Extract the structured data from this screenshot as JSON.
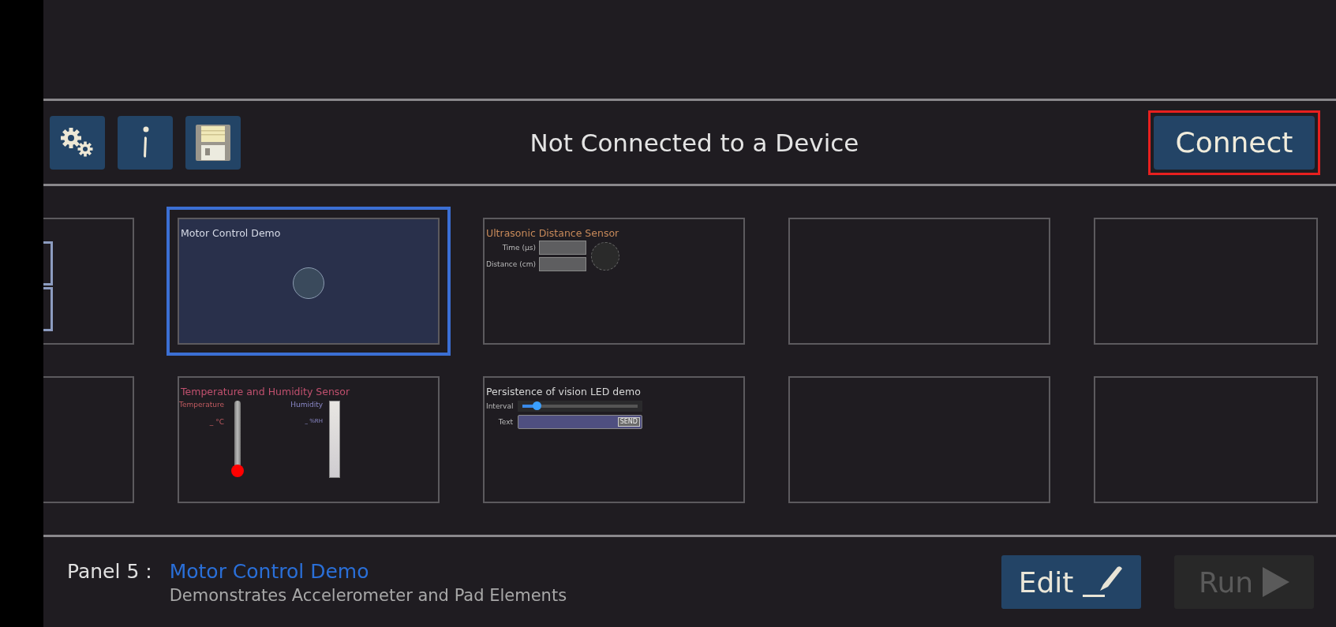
{
  "toolbar": {
    "status": "Not Connected to a Device",
    "connect": {
      "label": "Connect",
      "highlighted": true
    }
  },
  "panels": [
    {
      "kind": "partial",
      "selected": false
    },
    {
      "kind": "joystick",
      "selected": true,
      "title": "Motor Control Demo",
      "color": "#d8dce8"
    },
    {
      "kind": "ultrasonic",
      "selected": false,
      "title": "Ultrasonic Distance Sensor",
      "color": "#c88a5a",
      "labels": [
        "Time (µs)",
        "Distance (cm)"
      ]
    },
    {
      "kind": "empty",
      "selected": false
    },
    {
      "kind": "empty",
      "selected": false
    },
    {
      "kind": "blank",
      "selected": false
    },
    {
      "kind": "climate",
      "selected": false,
      "title": "Temperature and Humidity Sensor",
      "color": "#c0506e",
      "temperature": {
        "label": "Temperature",
        "reading": "_ °C"
      },
      "humidity": {
        "label": "Humidity",
        "reading": "_ %RH"
      }
    },
    {
      "kind": "pov",
      "selected": false,
      "title": "Persistence of vision LED demo",
      "color": "#d8d8d8",
      "interval": {
        "label": "Interval",
        "level": 0.12
      },
      "text": {
        "label": "Text",
        "button": "SEND"
      }
    },
    {
      "kind": "empty",
      "selected": false
    },
    {
      "kind": "empty",
      "selected": false
    }
  ],
  "footer": {
    "panel": "Panel 5 :",
    "title": "Motor Control Demo",
    "description": "Demonstrates Accelerometer and Pad Elements",
    "edit": {
      "label": "Edit",
      "disabled": false
    },
    "run": {
      "label": "Run",
      "disabled": true
    }
  }
}
